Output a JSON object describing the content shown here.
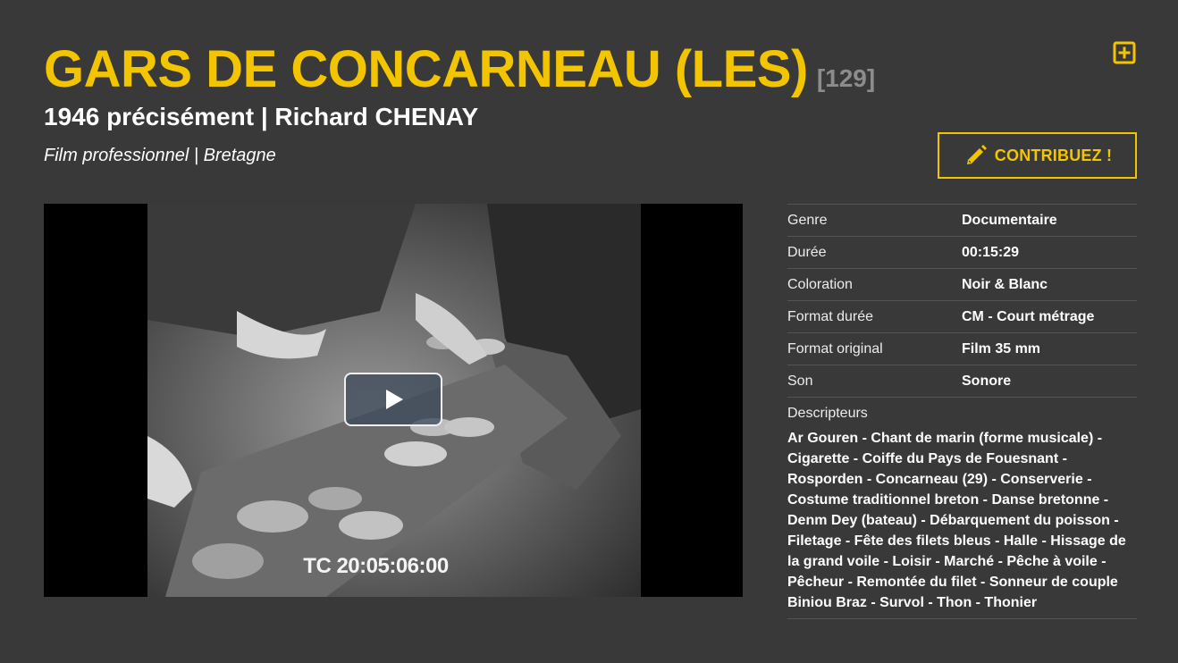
{
  "header": {
    "title": "GARS DE CONCARNEAU (LES)",
    "reference": "[129]",
    "subtitle": "1946 précisément | Richard CHENAY",
    "category": "Film professionnel | Bretagne"
  },
  "actions": {
    "add_icon": "plus-square-icon",
    "contribute_label": "CONTRIBUEZ !",
    "contribute_icon": "pencil-icon"
  },
  "player": {
    "timecode": "TC 20:05:06:00",
    "play_icon": "play-icon"
  },
  "metadata": [
    {
      "label": "Genre",
      "value": "Documentaire"
    },
    {
      "label": "Durée",
      "value": "00:15:29"
    },
    {
      "label": "Coloration",
      "value": "Noir & Blanc"
    },
    {
      "label": "Format durée",
      "value": "CM - Court métrage"
    },
    {
      "label": "Format original",
      "value": "Film 35 mm"
    },
    {
      "label": "Son",
      "value": "Sonore"
    }
  ],
  "descriptors": {
    "label": "Descripteurs",
    "text": "Ar Gouren - Chant de marin (forme musicale) - Cigarette - Coiffe du Pays de Fouesnant - Rosporden - Concarneau (29) - Conserverie - Costume traditionnel breton - Danse bretonne - Denm Dey (bateau) - Débarquement du poisson - Filetage - Fête des filets bleus - Halle - Hissage de la grand voile - Loisir - Marché - Pêche à voile - Pêcheur - Remontée du filet - Sonneur de couple Biniou Braz - Survol - Thon - Thonier"
  },
  "colors": {
    "background": "#393939",
    "accent": "#f2c500",
    "muted": "#8c8c8c"
  }
}
